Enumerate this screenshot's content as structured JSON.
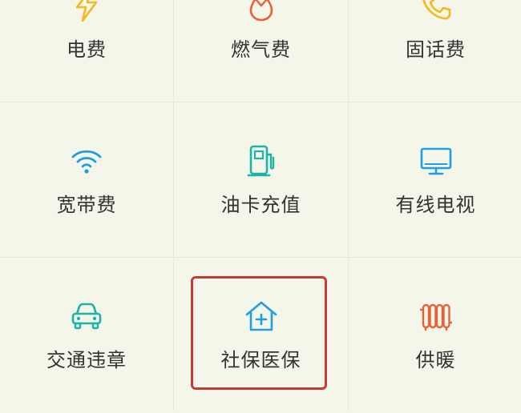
{
  "tiles": [
    {
      "label": "电费",
      "icon": "lightning-icon",
      "color": "#f2b91c"
    },
    {
      "label": "燃气费",
      "icon": "gas-flame-icon",
      "color": "#e8613a"
    },
    {
      "label": "固话费",
      "icon": "phone-icon",
      "color": "#f2b91c"
    },
    {
      "label": "宽带费",
      "icon": "wifi-icon",
      "color": "#1e9ee6"
    },
    {
      "label": "油卡充值",
      "icon": "gas-pump-icon",
      "color": "#1bb3a5"
    },
    {
      "label": "有线电视",
      "icon": "tv-monitor-icon",
      "color": "#1e9ee6"
    },
    {
      "label": "交通违章",
      "icon": "car-icon",
      "color": "#1bb3a5"
    },
    {
      "label": "社保医保",
      "icon": "medical-house-icon",
      "color": "#1e9ee6"
    },
    {
      "label": "供暖",
      "icon": "radiator-icon",
      "color": "#e8613a"
    }
  ],
  "highlight_color": "#c83a36"
}
